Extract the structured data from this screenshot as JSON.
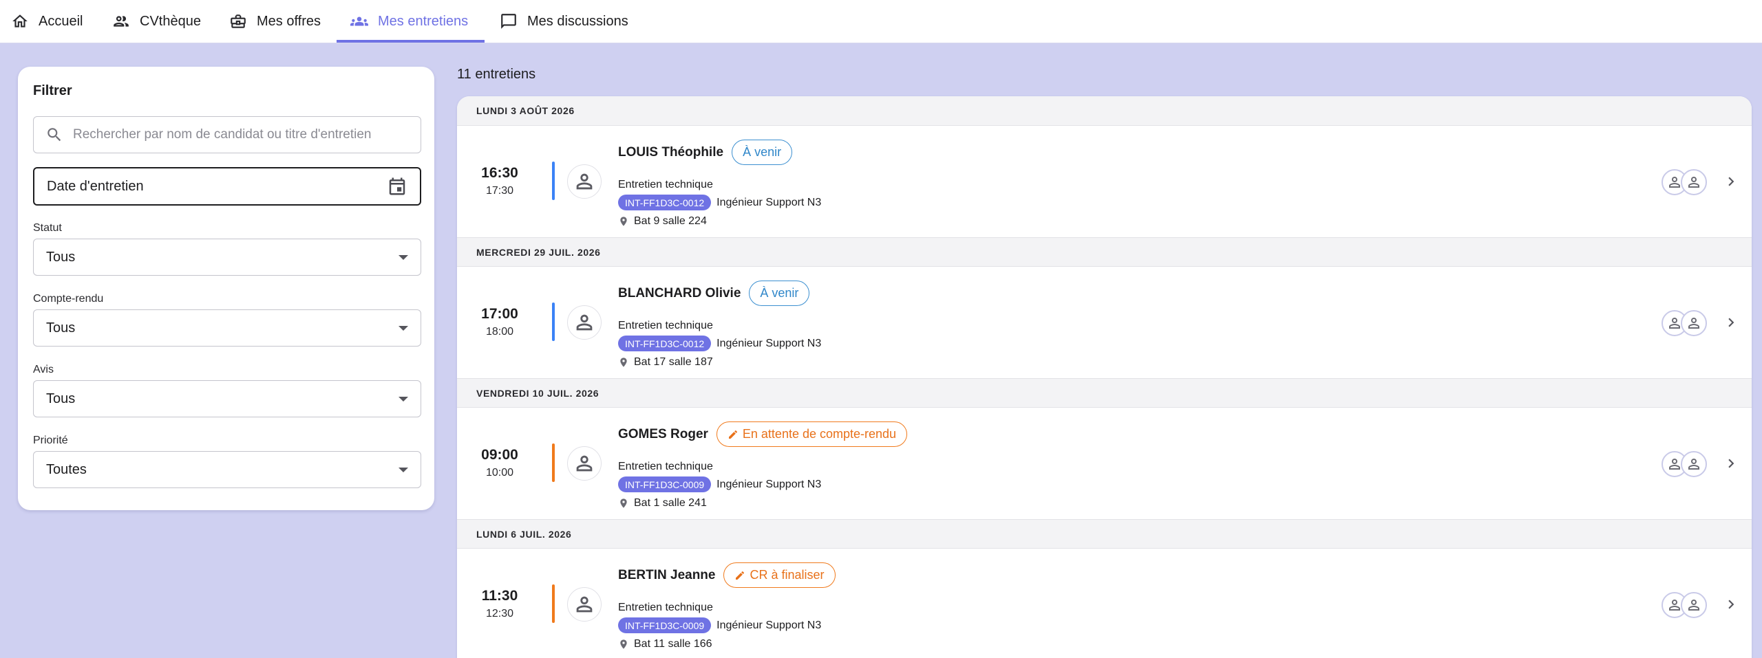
{
  "nav": {
    "items": [
      {
        "label": "Accueil",
        "icon": "home-icon"
      },
      {
        "label": "CVthèque",
        "icon": "people-icon"
      },
      {
        "label": "Mes offres",
        "icon": "briefcase-icon"
      },
      {
        "label": "Mes entretiens",
        "icon": "group-icon",
        "active": true
      },
      {
        "label": "Mes discussions",
        "icon": "chat-icon"
      }
    ]
  },
  "colors": {
    "accent": "#6f72e4",
    "background": "#cfd0f1",
    "upcoming": "#3b82f6",
    "pending": "#f07a1c"
  },
  "filter": {
    "title": "Filtrer",
    "search_placeholder": "Rechercher par nom de candidat ou titre d'entretien",
    "date_label": "Date d'entretien",
    "status_label": "Statut",
    "status_value": "Tous",
    "report_label": "Compte-rendu",
    "report_value": "Tous",
    "opinion_label": "Avis",
    "opinion_value": "Tous",
    "priority_label": "Priorité",
    "priority_value": "Toutes"
  },
  "list": {
    "count_text": "11 entretiens",
    "days": [
      {
        "date": "LUNDI 3 AOÛT 2026",
        "interview": {
          "start": "16:30",
          "end": "17:30",
          "candidate": "LOUIS Théophile",
          "status": "À venir",
          "status_kind": "upcoming",
          "type": "Entretien technique",
          "ref": "INT-FF1D3C-0012",
          "position": "Ingénieur Support N3",
          "location": "Bat 9 salle 224"
        }
      },
      {
        "date": "MERCREDI 29 JUIL. 2026",
        "interview": {
          "start": "17:00",
          "end": "18:00",
          "candidate": "BLANCHARD Olivie",
          "status": "À venir",
          "status_kind": "upcoming",
          "type": "Entretien technique",
          "ref": "INT-FF1D3C-0012",
          "position": "Ingénieur Support N3",
          "location": "Bat 17 salle 187"
        }
      },
      {
        "date": "VENDREDI 10 JUIL. 2026",
        "interview": {
          "start": "09:00",
          "end": "10:00",
          "candidate": "GOMES Roger",
          "status": "En attente de compte-rendu",
          "status_kind": "pending",
          "type": "Entretien technique",
          "ref": "INT-FF1D3C-0009",
          "position": "Ingénieur Support N3",
          "location": "Bat 1 salle 241"
        }
      },
      {
        "date": "LUNDI 6 JUIL. 2026",
        "interview": {
          "start": "11:30",
          "end": "12:30",
          "candidate": "BERTIN Jeanne",
          "status": "CR à finaliser",
          "status_kind": "pending",
          "type": "Entretien technique",
          "ref": "INT-FF1D3C-0009",
          "position": "Ingénieur Support N3",
          "location": "Bat 11 salle 166"
        }
      }
    ]
  }
}
